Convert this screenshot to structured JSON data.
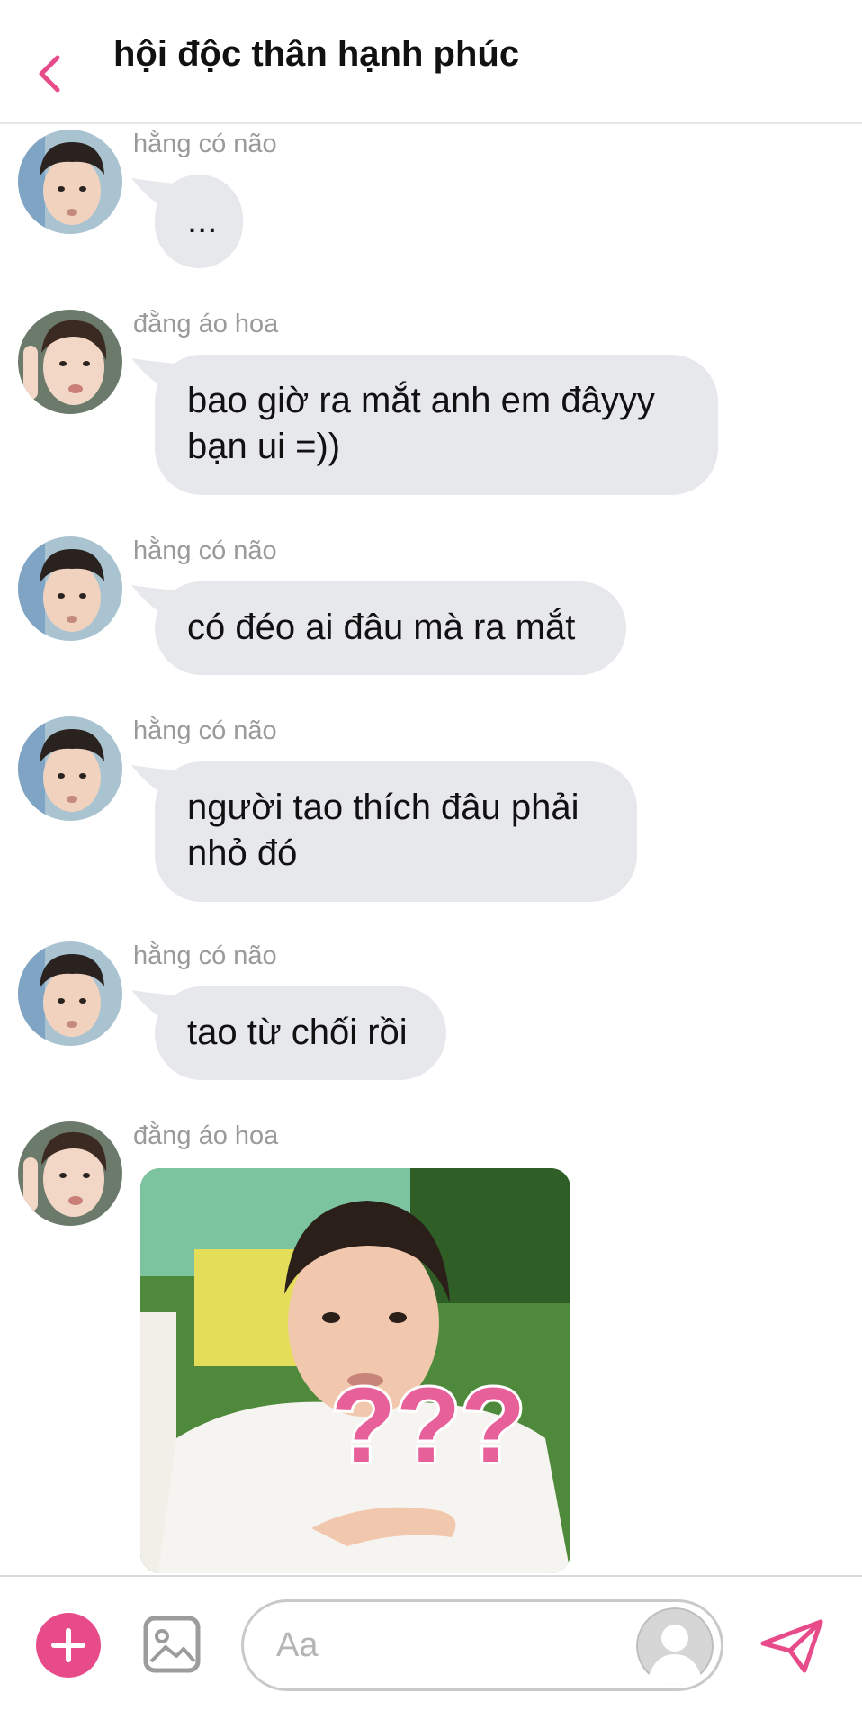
{
  "header": {
    "title": "hội độc thân hạnh phúc"
  },
  "messages": [
    {
      "sender": "hằng có não",
      "text": "..."
    },
    {
      "sender": "đằng áo hoa",
      "text": "bao giờ ra mắt anh em đâyyy bạn ui =))"
    },
    {
      "sender": "hằng có não",
      "text": "có đéo ai đâu mà ra mắt"
    },
    {
      "sender": "hằng có não",
      "text": "người tao thích đâu phải nhỏ đó"
    },
    {
      "sender": "hằng có não",
      "text": "tao từ chối rồi"
    },
    {
      "sender": "đằng áo hoa",
      "sticker_text": "???"
    }
  ],
  "composer": {
    "placeholder": "Aa"
  },
  "icons": {
    "back": "chevron-left-icon",
    "add": "plus-icon",
    "image": "image-icon",
    "profile": "user-icon",
    "send": "send-icon"
  },
  "colors": {
    "accent": "#e84b8a",
    "bubble": "#e7e8ec",
    "sender_text": "#9a9a9a"
  }
}
